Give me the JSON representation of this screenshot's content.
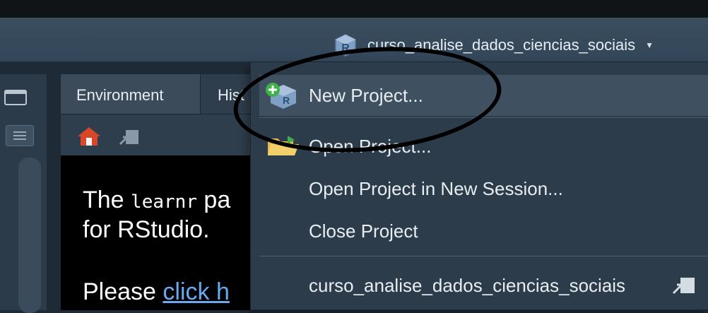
{
  "project_switcher": {
    "project_name": "curso_analise_dados_ciencias_sociais",
    "icon": "r-project-icon",
    "caret_icon": "caret-down-icon"
  },
  "env_pane": {
    "tabs": [
      {
        "label": "Environment"
      },
      {
        "label": "Hist"
      }
    ],
    "toolbar_icons": [
      "home-icon",
      "import-icon"
    ],
    "message": {
      "line1_pre": "The ",
      "line1_code": "learnr",
      "line1_post": " pa",
      "line2": "for RStudio.",
      "line3_pre": "Please ",
      "line3_link": "click h"
    }
  },
  "menu": {
    "items": [
      {
        "label": "New Project...",
        "icon": "new-project-icon",
        "highlighted": true
      },
      {
        "label": "Open Project...",
        "icon": "open-folder-icon"
      },
      {
        "label": "Open Project in New Session..."
      },
      {
        "label": "Close Project"
      },
      {
        "label": "curso_analise_dados_ciencias_sociais",
        "icon": "open-recent-icon"
      }
    ]
  },
  "annotation": {
    "shape": "hand-drawn-ellipse",
    "color": "#000000"
  },
  "colors": {
    "toolbar": "#3b4d5e",
    "menu_bg": "#2d3c4a",
    "menu_highlight": "#3f5060",
    "text": "#e8edf1",
    "link": "#6aa9ee",
    "home_red": "#d9472b"
  }
}
